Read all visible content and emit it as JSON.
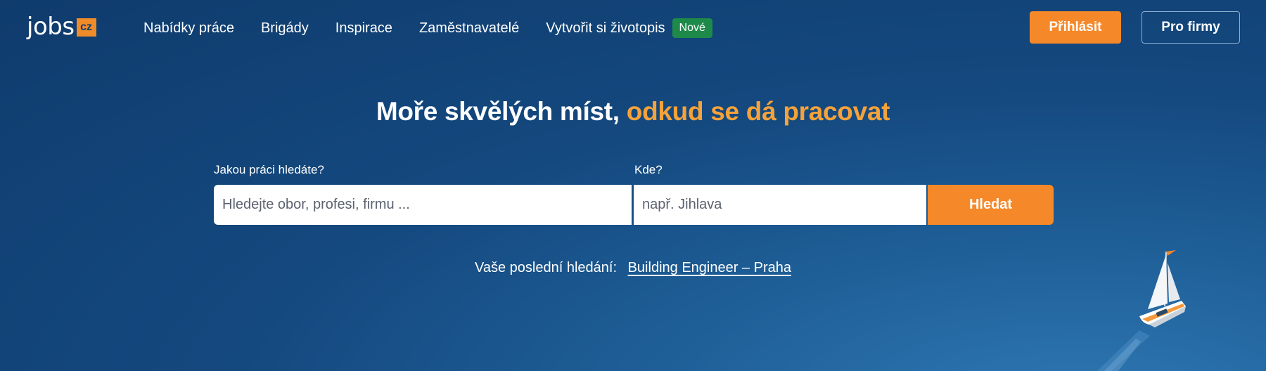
{
  "header": {
    "logo": {
      "text": "jobs",
      "badge": "cz"
    },
    "nav": [
      {
        "label": "Nabídky práce"
      },
      {
        "label": "Brigády"
      },
      {
        "label": "Inspirace"
      },
      {
        "label": "Zaměstnavatelé"
      },
      {
        "label": "Vytvořit si životopis"
      }
    ],
    "new_badge": "Nové",
    "login_label": "Přihlásit",
    "firms_label": "Pro firmy"
  },
  "hero": {
    "title_main": "Moře skvělých míst,",
    "title_accent": "odkud se dá pracovat"
  },
  "search": {
    "what_label": "Jakou práci hledáte?",
    "what_placeholder": "Hledejte obor, profesi, firmu ...",
    "where_label": "Kde?",
    "where_placeholder": "např. Jihlava",
    "button_label": "Hledat"
  },
  "recent": {
    "label": "Vaše poslední hledání:",
    "link": "Building Engineer – Praha"
  },
  "colors": {
    "accent": "#f5892a",
    "headline_accent": "#f5a23a",
    "background": "#14497f",
    "badge_green": "#1e8a4a"
  },
  "icons": {
    "decoration": "sailboat-icon"
  }
}
